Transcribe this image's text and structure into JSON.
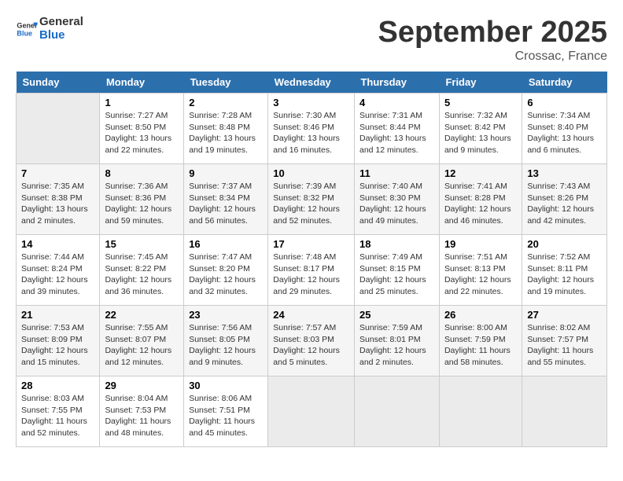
{
  "header": {
    "logo_text_general": "General",
    "logo_text_blue": "Blue",
    "month_title": "September 2025",
    "subtitle": "Crossac, France"
  },
  "calendar": {
    "days_of_week": [
      "Sunday",
      "Monday",
      "Tuesday",
      "Wednesday",
      "Thursday",
      "Friday",
      "Saturday"
    ],
    "weeks": [
      [
        {
          "day": "",
          "info": ""
        },
        {
          "day": "1",
          "info": "Sunrise: 7:27 AM\nSunset: 8:50 PM\nDaylight: 13 hours\nand 22 minutes."
        },
        {
          "day": "2",
          "info": "Sunrise: 7:28 AM\nSunset: 8:48 PM\nDaylight: 13 hours\nand 19 minutes."
        },
        {
          "day": "3",
          "info": "Sunrise: 7:30 AM\nSunset: 8:46 PM\nDaylight: 13 hours\nand 16 minutes."
        },
        {
          "day": "4",
          "info": "Sunrise: 7:31 AM\nSunset: 8:44 PM\nDaylight: 13 hours\nand 12 minutes."
        },
        {
          "day": "5",
          "info": "Sunrise: 7:32 AM\nSunset: 8:42 PM\nDaylight: 13 hours\nand 9 minutes."
        },
        {
          "day": "6",
          "info": "Sunrise: 7:34 AM\nSunset: 8:40 PM\nDaylight: 13 hours\nand 6 minutes."
        }
      ],
      [
        {
          "day": "7",
          "info": "Sunrise: 7:35 AM\nSunset: 8:38 PM\nDaylight: 13 hours\nand 2 minutes."
        },
        {
          "day": "8",
          "info": "Sunrise: 7:36 AM\nSunset: 8:36 PM\nDaylight: 12 hours\nand 59 minutes."
        },
        {
          "day": "9",
          "info": "Sunrise: 7:37 AM\nSunset: 8:34 PM\nDaylight: 12 hours\nand 56 minutes."
        },
        {
          "day": "10",
          "info": "Sunrise: 7:39 AM\nSunset: 8:32 PM\nDaylight: 12 hours\nand 52 minutes."
        },
        {
          "day": "11",
          "info": "Sunrise: 7:40 AM\nSunset: 8:30 PM\nDaylight: 12 hours\nand 49 minutes."
        },
        {
          "day": "12",
          "info": "Sunrise: 7:41 AM\nSunset: 8:28 PM\nDaylight: 12 hours\nand 46 minutes."
        },
        {
          "day": "13",
          "info": "Sunrise: 7:43 AM\nSunset: 8:26 PM\nDaylight: 12 hours\nand 42 minutes."
        }
      ],
      [
        {
          "day": "14",
          "info": "Sunrise: 7:44 AM\nSunset: 8:24 PM\nDaylight: 12 hours\nand 39 minutes."
        },
        {
          "day": "15",
          "info": "Sunrise: 7:45 AM\nSunset: 8:22 PM\nDaylight: 12 hours\nand 36 minutes."
        },
        {
          "day": "16",
          "info": "Sunrise: 7:47 AM\nSunset: 8:20 PM\nDaylight: 12 hours\nand 32 minutes."
        },
        {
          "day": "17",
          "info": "Sunrise: 7:48 AM\nSunset: 8:17 PM\nDaylight: 12 hours\nand 29 minutes."
        },
        {
          "day": "18",
          "info": "Sunrise: 7:49 AM\nSunset: 8:15 PM\nDaylight: 12 hours\nand 25 minutes."
        },
        {
          "day": "19",
          "info": "Sunrise: 7:51 AM\nSunset: 8:13 PM\nDaylight: 12 hours\nand 22 minutes."
        },
        {
          "day": "20",
          "info": "Sunrise: 7:52 AM\nSunset: 8:11 PM\nDaylight: 12 hours\nand 19 minutes."
        }
      ],
      [
        {
          "day": "21",
          "info": "Sunrise: 7:53 AM\nSunset: 8:09 PM\nDaylight: 12 hours\nand 15 minutes."
        },
        {
          "day": "22",
          "info": "Sunrise: 7:55 AM\nSunset: 8:07 PM\nDaylight: 12 hours\nand 12 minutes."
        },
        {
          "day": "23",
          "info": "Sunrise: 7:56 AM\nSunset: 8:05 PM\nDaylight: 12 hours\nand 9 minutes."
        },
        {
          "day": "24",
          "info": "Sunrise: 7:57 AM\nSunset: 8:03 PM\nDaylight: 12 hours\nand 5 minutes."
        },
        {
          "day": "25",
          "info": "Sunrise: 7:59 AM\nSunset: 8:01 PM\nDaylight: 12 hours\nand 2 minutes."
        },
        {
          "day": "26",
          "info": "Sunrise: 8:00 AM\nSunset: 7:59 PM\nDaylight: 11 hours\nand 58 minutes."
        },
        {
          "day": "27",
          "info": "Sunrise: 8:02 AM\nSunset: 7:57 PM\nDaylight: 11 hours\nand 55 minutes."
        }
      ],
      [
        {
          "day": "28",
          "info": "Sunrise: 8:03 AM\nSunset: 7:55 PM\nDaylight: 11 hours\nand 52 minutes."
        },
        {
          "day": "29",
          "info": "Sunrise: 8:04 AM\nSunset: 7:53 PM\nDaylight: 11 hours\nand 48 minutes."
        },
        {
          "day": "30",
          "info": "Sunrise: 8:06 AM\nSunset: 7:51 PM\nDaylight: 11 hours\nand 45 minutes."
        },
        {
          "day": "",
          "info": ""
        },
        {
          "day": "",
          "info": ""
        },
        {
          "day": "",
          "info": ""
        },
        {
          "day": "",
          "info": ""
        }
      ]
    ]
  }
}
